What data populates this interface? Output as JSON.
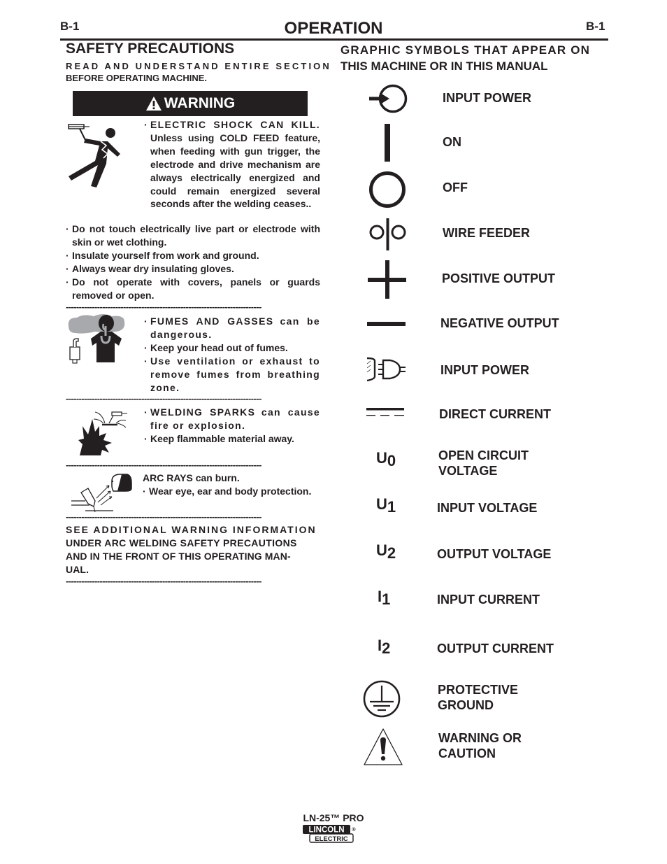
{
  "header": {
    "page_left": "B-1",
    "page_right": "B-1",
    "title": "OPERATION"
  },
  "safety": {
    "title": "SAFETY PRECAUTIONS",
    "subtitle_line1": "READ AND UNDERSTAND ENTIRE SECTION",
    "subtitle_line2": "BEFORE OPERATING MACHINE.",
    "warning_banner": "WARNING",
    "shock": {
      "icon": "electric-shock-icon",
      "lead": "ELECTRIC SHOCK CAN KILL.",
      "text": "Unless using COLD FEED feature, when feeding with gun trigger, the electrode and drive mechanism are always electrically energized and could remain energized several seconds after the welding ceases..",
      "bullets": [
        "Do not touch electrically live part or electrode with skin or wet clothing.",
        "Insulate yourself from work and ground.",
        "Always wear dry insulating gloves.",
        "Do not operate with covers, panels or guards removed or open."
      ]
    },
    "fumes": {
      "icon": "fumes-icon",
      "lead": "FUMES AND GASSES",
      "lead_rest": "can be dangerous.",
      "bullets": [
        "Keep your head out of fumes.",
        "Use ventilation or exhaust to remove fumes from breathing zone."
      ]
    },
    "sparks": {
      "icon": "welding-sparks-icon",
      "lead": "WELDING SPARKS",
      "lead_rest": "can cause fire or explosion.",
      "bullets": [
        "Keep flammable material away."
      ]
    },
    "arc": {
      "icon": "arc-rays-icon",
      "lead": "ARC RAYS can burn.",
      "bullets": [
        "Wear eye, ear and body protection."
      ]
    },
    "additional_line1": "SEE ADDITIONAL WARNING INFORMATION",
    "additional_line2": "UNDER ARC WELDING SAFETY PRECAUTIONS",
    "additional_line3": "AND IN THE FRONT OF THIS OPERATING MAN-",
    "additional_line4": "UAL.",
    "dash_line": "---------------------------------------------------------------------------"
  },
  "symbols": {
    "title_line1": "GRAPHIC SYMBOLS THAT APPEAR ON",
    "title_line2": "THIS MACHINE OR IN THIS MANUAL",
    "items": [
      {
        "icon": "input-power-icon",
        "label": "INPUT POWER"
      },
      {
        "icon": "on-icon",
        "label": "ON"
      },
      {
        "icon": "off-icon",
        "label": "OFF"
      },
      {
        "icon": "wire-feeder-icon",
        "label": "WIRE FEEDER"
      },
      {
        "icon": "positive-output-icon",
        "label": "POSITIVE OUTPUT"
      },
      {
        "icon": "negative-output-icon",
        "label": "NEGATIVE OUTPUT"
      },
      {
        "icon": "input-power-plug-icon",
        "label": "INPUT POWER"
      },
      {
        "icon": "direct-current-icon",
        "label": "DIRECT CURRENT"
      },
      {
        "symbol": "U",
        "sub": "0",
        "label_line1": "OPEN CIRCUIT",
        "label_line2": "VOLTAGE"
      },
      {
        "symbol": "U",
        "sub": "1",
        "label": "INPUT VOLTAGE"
      },
      {
        "symbol": "U",
        "sub": "2",
        "label": "OUTPUT VOLTAGE"
      },
      {
        "symbol": "I",
        "sub": "1",
        "label": "INPUT CURRENT"
      },
      {
        "symbol": "I",
        "sub": "2",
        "label": "OUTPUT CURRENT"
      },
      {
        "icon": "protective-ground-icon",
        "label_line1": "PROTECTIVE",
        "label_line2": "GROUND"
      },
      {
        "icon": "warning-triangle-icon",
        "label_line1": "WARNING OR",
        "label_line2": "CAUTION"
      }
    ]
  },
  "footer": {
    "model": "LN-25™ PRO",
    "logo_top": "LINCOLN",
    "logo_bottom": "ELECTRIC",
    "logo_mark": "®"
  }
}
